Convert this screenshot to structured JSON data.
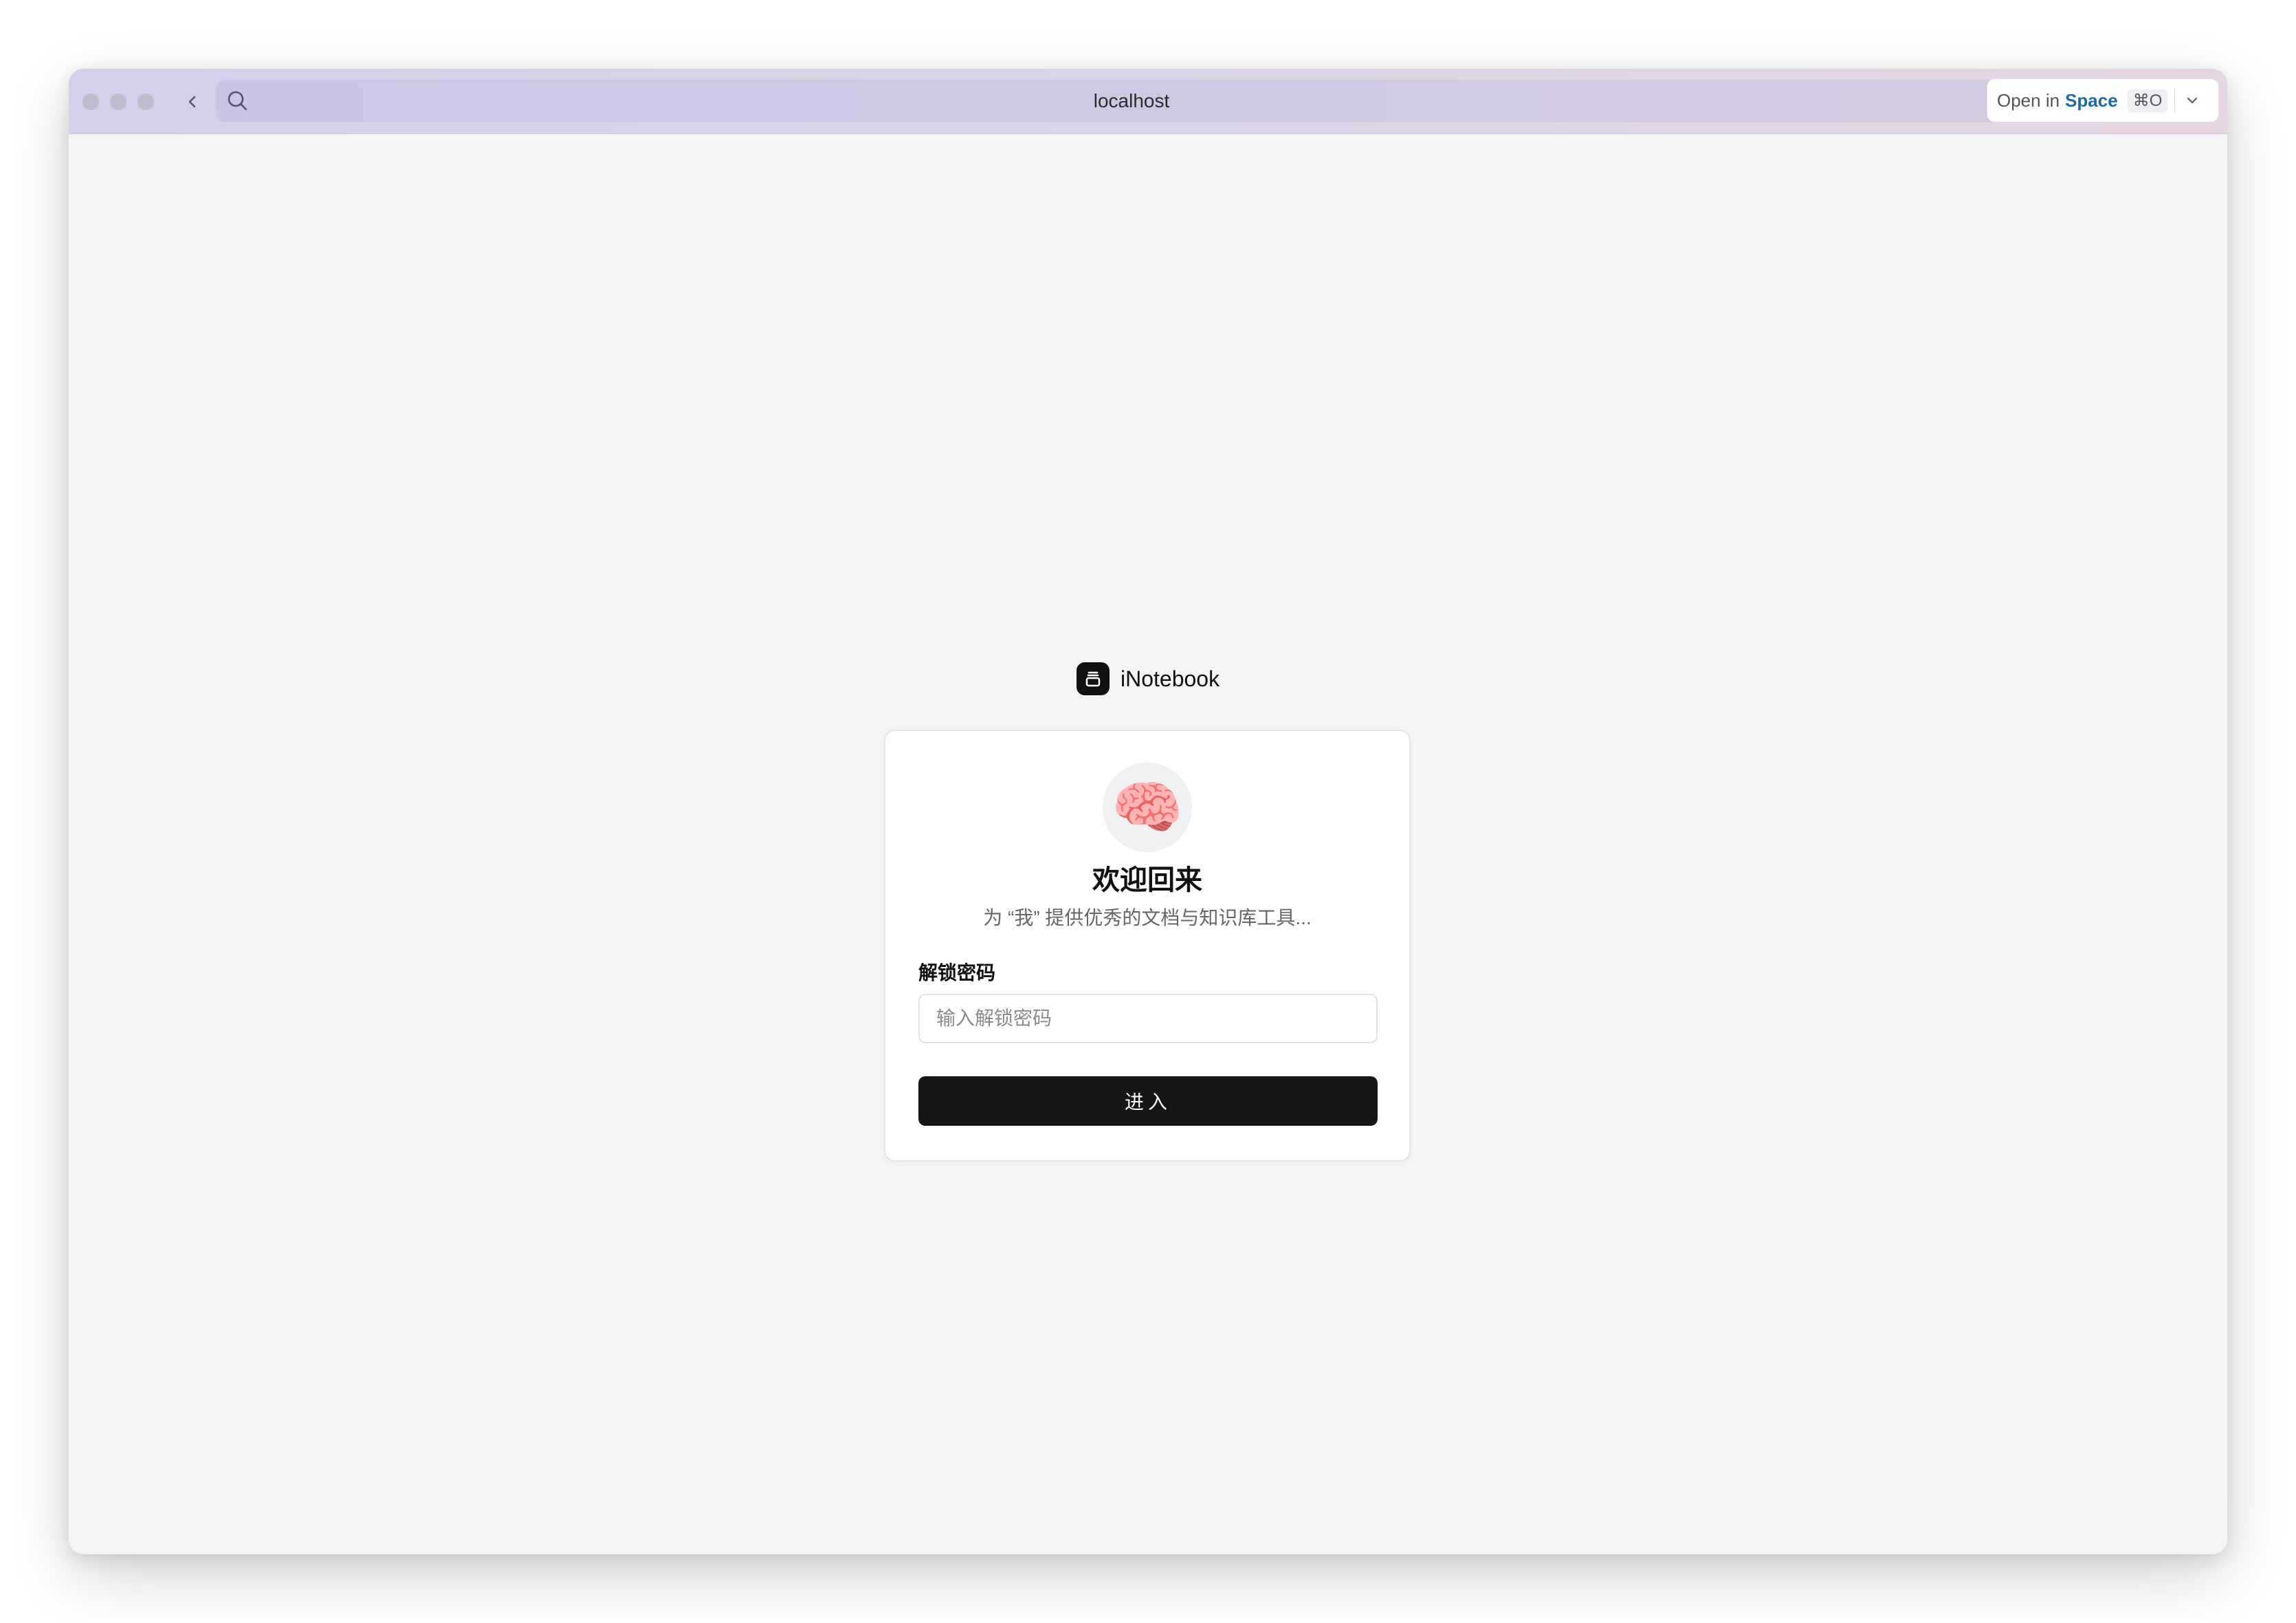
{
  "browser": {
    "url": "localhost",
    "open_in_label": "Open in",
    "space_label": "Space",
    "shortcut": "⌘O"
  },
  "icons": {
    "back": "chevron-left-icon",
    "search": "search-icon",
    "share": "share-icon",
    "link": "link-icon",
    "dropdown": "chevron-down-icon",
    "brand": "notebook-logo-icon",
    "avatar": "🧠"
  },
  "brand": {
    "name": "iNotebook"
  },
  "login": {
    "avatar_emoji": "🧠",
    "title": "欢迎回来",
    "subtitle": "为 “我” 提供优秀的文档与知识库工具...",
    "password_label": "解锁密码",
    "password_placeholder": "输入解锁密码",
    "password_value": "",
    "submit_label": "进入"
  },
  "colors": {
    "page_background": "#f4f4f4",
    "card_background": "#ffffff",
    "button_background": "#161616",
    "button_text": "#ffffff",
    "space_accent": "#1d6ca0"
  }
}
